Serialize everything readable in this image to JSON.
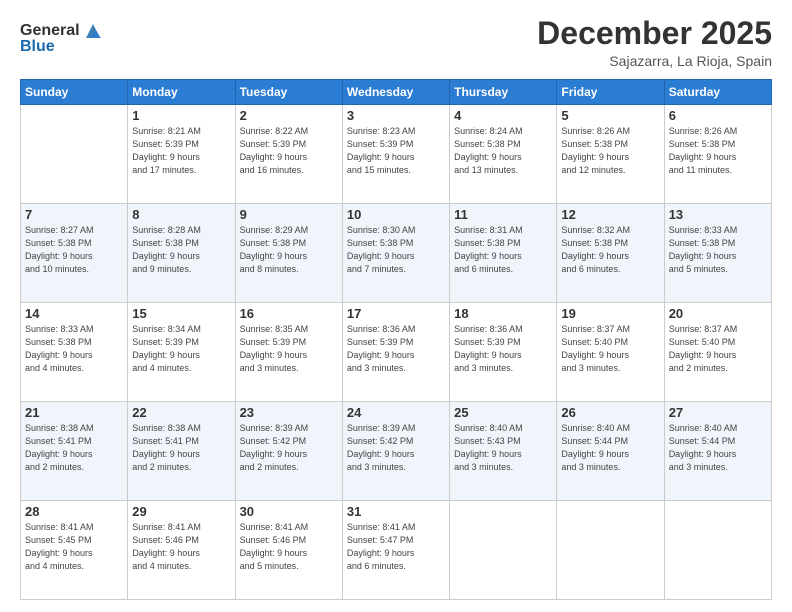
{
  "header": {
    "logo_general": "General",
    "logo_blue": "Blue",
    "month": "December 2025",
    "location": "Sajazarra, La Rioja, Spain"
  },
  "weekdays": [
    "Sunday",
    "Monday",
    "Tuesday",
    "Wednesday",
    "Thursday",
    "Friday",
    "Saturday"
  ],
  "weeks": [
    [
      {
        "day": "",
        "info": ""
      },
      {
        "day": "1",
        "info": "Sunrise: 8:21 AM\nSunset: 5:39 PM\nDaylight: 9 hours\nand 17 minutes."
      },
      {
        "day": "2",
        "info": "Sunrise: 8:22 AM\nSunset: 5:39 PM\nDaylight: 9 hours\nand 16 minutes."
      },
      {
        "day": "3",
        "info": "Sunrise: 8:23 AM\nSunset: 5:39 PM\nDaylight: 9 hours\nand 15 minutes."
      },
      {
        "day": "4",
        "info": "Sunrise: 8:24 AM\nSunset: 5:38 PM\nDaylight: 9 hours\nand 13 minutes."
      },
      {
        "day": "5",
        "info": "Sunrise: 8:26 AM\nSunset: 5:38 PM\nDaylight: 9 hours\nand 12 minutes."
      },
      {
        "day": "6",
        "info": "Sunrise: 8:26 AM\nSunset: 5:38 PM\nDaylight: 9 hours\nand 11 minutes."
      }
    ],
    [
      {
        "day": "7",
        "info": "Sunrise: 8:27 AM\nSunset: 5:38 PM\nDaylight: 9 hours\nand 10 minutes."
      },
      {
        "day": "8",
        "info": "Sunrise: 8:28 AM\nSunset: 5:38 PM\nDaylight: 9 hours\nand 9 minutes."
      },
      {
        "day": "9",
        "info": "Sunrise: 8:29 AM\nSunset: 5:38 PM\nDaylight: 9 hours\nand 8 minutes."
      },
      {
        "day": "10",
        "info": "Sunrise: 8:30 AM\nSunset: 5:38 PM\nDaylight: 9 hours\nand 7 minutes."
      },
      {
        "day": "11",
        "info": "Sunrise: 8:31 AM\nSunset: 5:38 PM\nDaylight: 9 hours\nand 6 minutes."
      },
      {
        "day": "12",
        "info": "Sunrise: 8:32 AM\nSunset: 5:38 PM\nDaylight: 9 hours\nand 6 minutes."
      },
      {
        "day": "13",
        "info": "Sunrise: 8:33 AM\nSunset: 5:38 PM\nDaylight: 9 hours\nand 5 minutes."
      }
    ],
    [
      {
        "day": "14",
        "info": "Sunrise: 8:33 AM\nSunset: 5:38 PM\nDaylight: 9 hours\nand 4 minutes."
      },
      {
        "day": "15",
        "info": "Sunrise: 8:34 AM\nSunset: 5:39 PM\nDaylight: 9 hours\nand 4 minutes."
      },
      {
        "day": "16",
        "info": "Sunrise: 8:35 AM\nSunset: 5:39 PM\nDaylight: 9 hours\nand 3 minutes."
      },
      {
        "day": "17",
        "info": "Sunrise: 8:36 AM\nSunset: 5:39 PM\nDaylight: 9 hours\nand 3 minutes."
      },
      {
        "day": "18",
        "info": "Sunrise: 8:36 AM\nSunset: 5:39 PM\nDaylight: 9 hours\nand 3 minutes."
      },
      {
        "day": "19",
        "info": "Sunrise: 8:37 AM\nSunset: 5:40 PM\nDaylight: 9 hours\nand 3 minutes."
      },
      {
        "day": "20",
        "info": "Sunrise: 8:37 AM\nSunset: 5:40 PM\nDaylight: 9 hours\nand 2 minutes."
      }
    ],
    [
      {
        "day": "21",
        "info": "Sunrise: 8:38 AM\nSunset: 5:41 PM\nDaylight: 9 hours\nand 2 minutes."
      },
      {
        "day": "22",
        "info": "Sunrise: 8:38 AM\nSunset: 5:41 PM\nDaylight: 9 hours\nand 2 minutes."
      },
      {
        "day": "23",
        "info": "Sunrise: 8:39 AM\nSunset: 5:42 PM\nDaylight: 9 hours\nand 2 minutes."
      },
      {
        "day": "24",
        "info": "Sunrise: 8:39 AM\nSunset: 5:42 PM\nDaylight: 9 hours\nand 3 minutes."
      },
      {
        "day": "25",
        "info": "Sunrise: 8:40 AM\nSunset: 5:43 PM\nDaylight: 9 hours\nand 3 minutes."
      },
      {
        "day": "26",
        "info": "Sunrise: 8:40 AM\nSunset: 5:44 PM\nDaylight: 9 hours\nand 3 minutes."
      },
      {
        "day": "27",
        "info": "Sunrise: 8:40 AM\nSunset: 5:44 PM\nDaylight: 9 hours\nand 3 minutes."
      }
    ],
    [
      {
        "day": "28",
        "info": "Sunrise: 8:41 AM\nSunset: 5:45 PM\nDaylight: 9 hours\nand 4 minutes."
      },
      {
        "day": "29",
        "info": "Sunrise: 8:41 AM\nSunset: 5:46 PM\nDaylight: 9 hours\nand 4 minutes."
      },
      {
        "day": "30",
        "info": "Sunrise: 8:41 AM\nSunset: 5:46 PM\nDaylight: 9 hours\nand 5 minutes."
      },
      {
        "day": "31",
        "info": "Sunrise: 8:41 AM\nSunset: 5:47 PM\nDaylight: 9 hours\nand 6 minutes."
      },
      {
        "day": "",
        "info": ""
      },
      {
        "day": "",
        "info": ""
      },
      {
        "day": "",
        "info": ""
      }
    ]
  ]
}
